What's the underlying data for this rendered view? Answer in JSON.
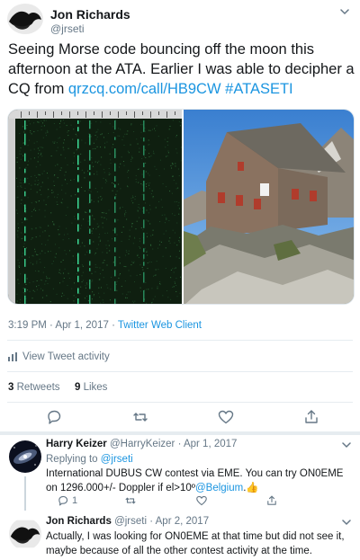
{
  "tweet": {
    "author_name": "Jon Richards",
    "author_handle": "@jrseti",
    "text_plain": "Seeing Morse code bouncing off the moon this afternoon at the ATA. Earlier I was able to decipher a CQ from ",
    "link": "qrzcq.com/call/HB9CW",
    "hashtag": "#ATASETI",
    "timestamp": "3:19 PM · Apr 1, 2017",
    "source": "Twitter Web Client",
    "activity_label": "View Tweet activity",
    "retweets_count": "3",
    "retweets_label": "Retweets",
    "likes_count": "9",
    "likes_label": "Likes"
  },
  "media": {
    "left": "waterfall spectrogram",
    "right": "mountain stone hut photo"
  },
  "replies": [
    {
      "name": "Harry Keizer",
      "handle": "@HarryKeizer",
      "date": "· Apr 1, 2017",
      "replying_prefix": "Replying to ",
      "replying_to": "@jrseti",
      "text_a": "International DUBUS CW contest via EME. You can try ON0EME on 1296.000+/- Doppler if el>10º",
      "mention": "@Belgium",
      "text_b": ".",
      "emoji": "👍",
      "reply_count": "1"
    },
    {
      "name": "Jon Richards",
      "handle": "@jrseti",
      "date": "· Apr 2, 2017",
      "text": "Actually, I was looking for ON0EME at that time but did not see it, maybe because of all the other contest activity at the time."
    }
  ],
  "icons": [
    "chevron-down-icon",
    "reply-icon",
    "retweet-icon",
    "like-icon",
    "share-icon",
    "bar-chart-icon"
  ],
  "colors": {
    "accent": "#1b95e0",
    "secondary_text": "#657786",
    "divider": "#e6ecf0",
    "spectrogram_bg": "#0f1f10",
    "spectrogram_signal": "#3ddc97"
  }
}
